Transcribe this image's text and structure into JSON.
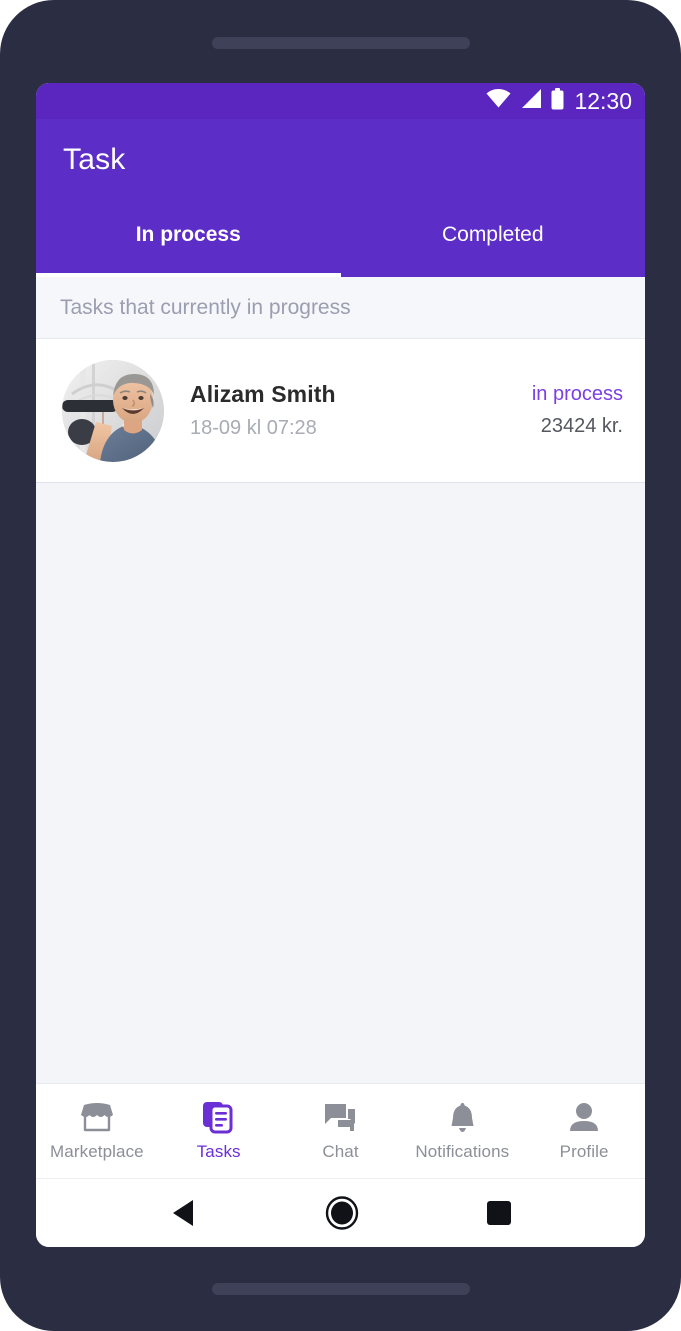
{
  "status_bar": {
    "time": "12:30",
    "icons": [
      "wifi-icon",
      "signal-icon",
      "battery-icon"
    ]
  },
  "app_bar": {
    "title": "Task",
    "background_color": "#5d2dc8"
  },
  "tabs": [
    {
      "label": "In process",
      "active": true
    },
    {
      "label": "Completed",
      "active": false
    }
  ],
  "section_header": {
    "label": "Tasks that currently in progress"
  },
  "tasks": [
    {
      "name": "Alizam Smith",
      "datetime": "18-09 kl 07:28",
      "status": "in process",
      "status_color": "#7b3fe4",
      "amount": "23424 kr.",
      "avatar": "worker-photo"
    }
  ],
  "bottom_nav": {
    "items": [
      {
        "label": "Marketplace",
        "icon": "store-icon",
        "active": false
      },
      {
        "label": "Tasks",
        "icon": "documents-icon",
        "active": true
      },
      {
        "label": "Chat",
        "icon": "chat-bubbles-icon",
        "active": false
      },
      {
        "label": "Notifications",
        "icon": "bell-icon",
        "active": false
      },
      {
        "label": "Profile",
        "icon": "person-icon",
        "active": false
      }
    ],
    "active_color": "#6b2fd6",
    "inactive_color": "#8d8f98"
  },
  "system_nav": {
    "buttons": [
      "back-button",
      "home-button",
      "recents-button"
    ]
  }
}
